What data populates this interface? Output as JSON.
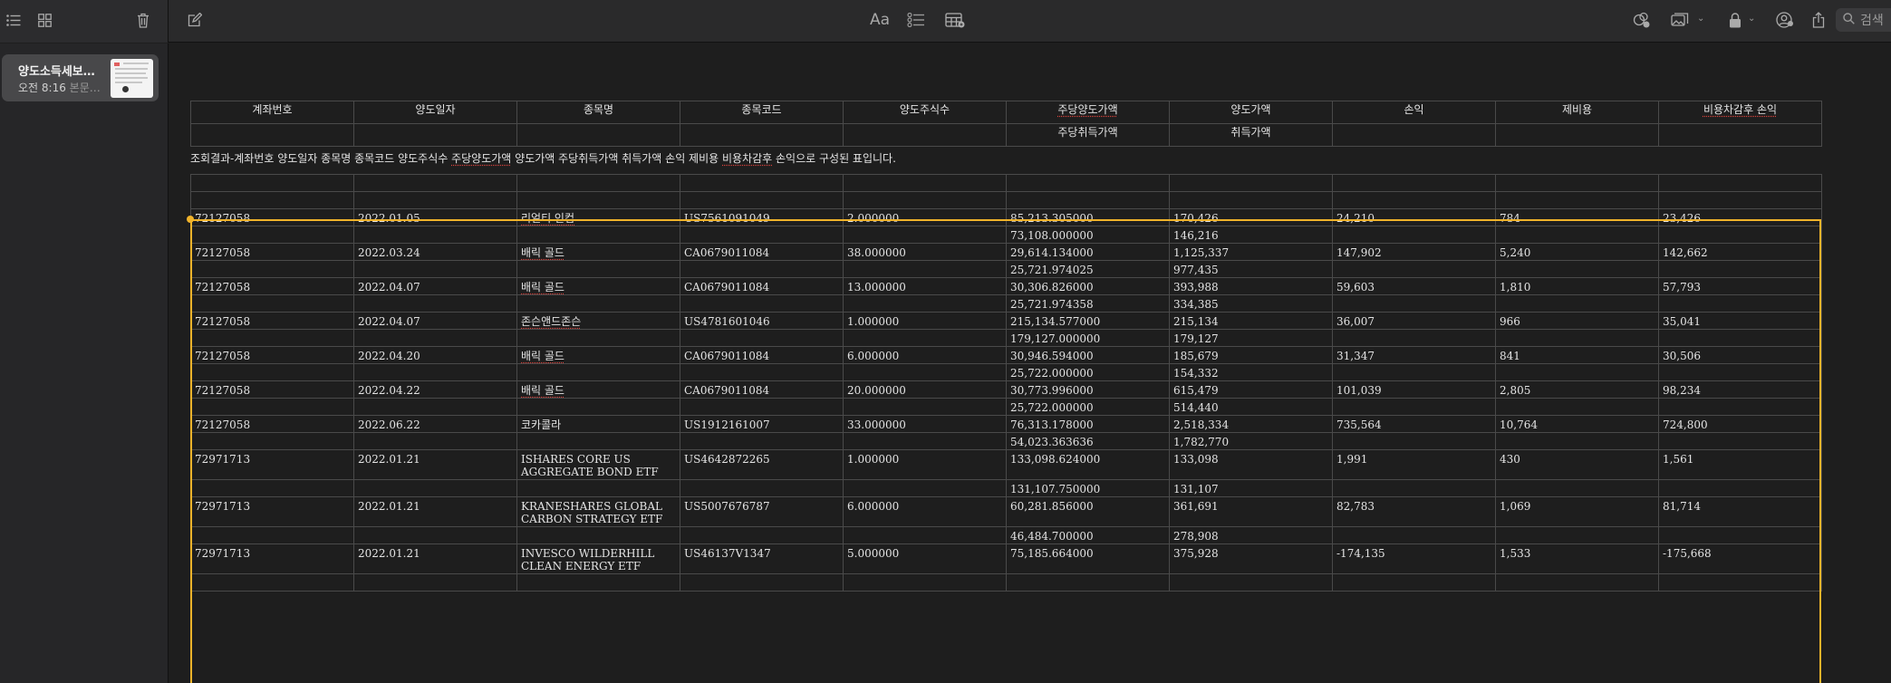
{
  "toolbar": {
    "list_view_icon": "list-icon",
    "gallery_view_icon": "grid-icon",
    "delete_icon": "trash-icon",
    "compose_icon": "compose-icon",
    "format_label": "Aa",
    "checklist_icon": "checklist-icon",
    "table_icon": "table-icon",
    "collab_icon": "collaborate-icon",
    "media_icon": "photo-icon",
    "lock_icon": "lock-icon",
    "share_person_icon": "person-share-icon",
    "share_icon": "share-icon",
    "search_placeholder": "검색"
  },
  "sidebar": {
    "notes": [
      {
        "title": "양도소득세보…",
        "time": "오전 8:16",
        "preview": "본문…"
      }
    ]
  },
  "header_table": {
    "row1": [
      "계좌번호",
      "양도일자",
      "종목명",
      "종목코드",
      "양도주식수",
      "주당양도가액",
      "양도가액",
      "손익",
      "제비용",
      "비용차감후 손익"
    ],
    "row2": [
      "",
      "",
      "",
      "",
      "",
      "주당취득가액",
      "취득가액",
      "",
      "",
      ""
    ]
  },
  "caption": {
    "part1": "조회결과-계좌번호 양도일자 종목명 종목코드 양도주식수 ",
    "spell1": "주당양도가액",
    "part2": " 양도가액 주당취득가액 취득가액 손익 제비용 ",
    "spell2": "비용차감후",
    "part3": " 손익으로 구성된 표입니다."
  },
  "rows": [
    {
      "account": "72127058",
      "date": "2022.01.05",
      "name": "리얼티 인컴",
      "code": "US7561091049",
      "qty": "2.000000",
      "unit_sale": "85,213.305000",
      "sale": "170,426",
      "pl": "24,210",
      "fee": "784",
      "net": "23,426",
      "unit_cost": "73,108.000000",
      "cost": "146,216"
    },
    {
      "account": "72127058",
      "date": "2022.03.24",
      "name": "배릭 골드",
      "code": "CA0679011084",
      "qty": "38.000000",
      "unit_sale": "29,614.134000",
      "sale": "1,125,337",
      "pl": "147,902",
      "fee": "5,240",
      "net": "142,662",
      "unit_cost": "25,721.974025",
      "cost": "977,435"
    },
    {
      "account": "72127058",
      "date": "2022.04.07",
      "name": "배릭 골드",
      "code": "CA0679011084",
      "qty": "13.000000",
      "unit_sale": "30,306.826000",
      "sale": "393,988",
      "pl": "59,603",
      "fee": "1,810",
      "net": "57,793",
      "unit_cost": "25,721.974358",
      "cost": "334,385"
    },
    {
      "account": "72127058",
      "date": "2022.04.07",
      "name": "존슨앤드존슨",
      "code": "US4781601046",
      "qty": "1.000000",
      "unit_sale": "215,134.577000",
      "sale": "215,134",
      "pl": "36,007",
      "fee": "966",
      "net": "35,041",
      "unit_cost": "179,127.000000",
      "cost": "179,127"
    },
    {
      "account": "72127058",
      "date": "2022.04.20",
      "name": "배릭 골드",
      "code": "CA0679011084",
      "qty": "6.000000",
      "unit_sale": "30,946.594000",
      "sale": "185,679",
      "pl": "31,347",
      "fee": "841",
      "net": "30,506",
      "unit_cost": "25,722.000000",
      "cost": "154,332"
    },
    {
      "account": "72127058",
      "date": "2022.04.22",
      "name": "배릭 골드",
      "code": "CA0679011084",
      "qty": "20.000000",
      "unit_sale": "30,773.996000",
      "sale": "615,479",
      "pl": "101,039",
      "fee": "2,805",
      "net": "98,234",
      "unit_cost": "25,722.000000",
      "cost": "514,440"
    },
    {
      "account": "72127058",
      "date": "2022.06.22",
      "name": "코카콜라",
      "code": "US1912161007",
      "qty": "33.000000",
      "unit_sale": "76,313.178000",
      "sale": "2,518,334",
      "pl": "735,564",
      "fee": "10,764",
      "net": "724,800",
      "unit_cost": "54,023.363636",
      "cost": "1,782,770"
    },
    {
      "account": "72971713",
      "date": "2022.01.21",
      "name": "ISHARES CORE US AGGREGATE BOND ETF",
      "code": "US4642872265",
      "qty": "1.000000",
      "unit_sale": "133,098.624000",
      "sale": "133,098",
      "pl": "1,991",
      "fee": "430",
      "net": "1,561",
      "unit_cost": "131,107.750000",
      "cost": "131,107"
    },
    {
      "account": "72971713",
      "date": "2022.01.21",
      "name": "KRANESHARES GLOBAL CARBON STRATEGY ETF",
      "code": "US5007676787",
      "qty": "6.000000",
      "unit_sale": "60,281.856000",
      "sale": "361,691",
      "pl": "82,783",
      "fee": "1,069",
      "net": "81,714",
      "unit_cost": "46,484.700000",
      "cost": "278,908"
    },
    {
      "account": "72971713",
      "date": "2022.01.21",
      "name": "INVESCO WILDERHILL CLEAN ENERGY ETF",
      "code": "US46137V1347",
      "qty": "5.000000",
      "unit_sale": "75,185.664000",
      "sale": "375,928",
      "pl": "-174,135",
      "fee": "1,533",
      "net": "-175,668",
      "unit_cost": "",
      "cost": ""
    }
  ],
  "colors": {
    "selection": "#f0b32a",
    "spellcheck": "#e0443e"
  }
}
